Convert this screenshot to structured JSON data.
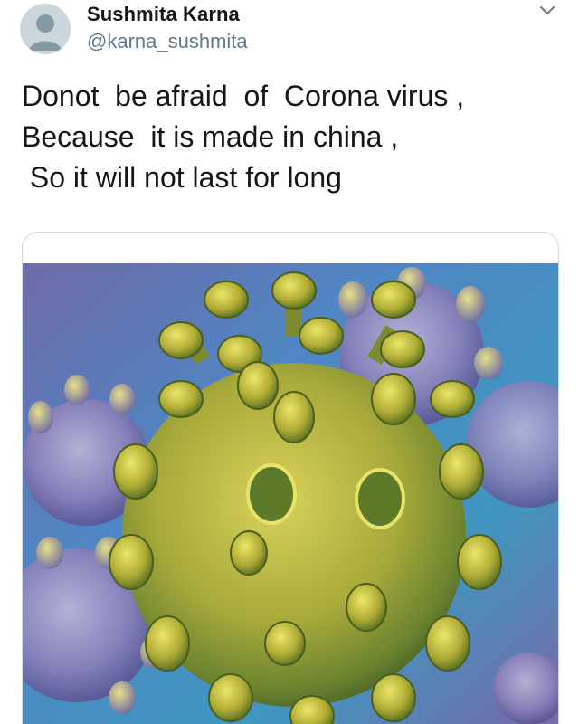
{
  "author": {
    "display_name": "Sushmita Karna",
    "handle": "@karna_sushmita",
    "avatar_icon": "default-avatar-icon"
  },
  "menu": {
    "icon": "chevron-down-icon"
  },
  "tweet": {
    "lines": [
      "Donot  be afraid  of  Corona virus ,",
      "Because  it is made in china ,",
      " So it will not last for long"
    ]
  },
  "media": {
    "subject": "coronavirus-illustration",
    "colors": {
      "background_blue": "#4f86c4",
      "background_purple": "#7b66a8",
      "virus_yellow": "#c9c33e",
      "virus_green": "#5f7f2e",
      "border": "#cfd9de"
    }
  },
  "colors": {
    "text": "#14171a",
    "secondary_text": "#657786"
  }
}
